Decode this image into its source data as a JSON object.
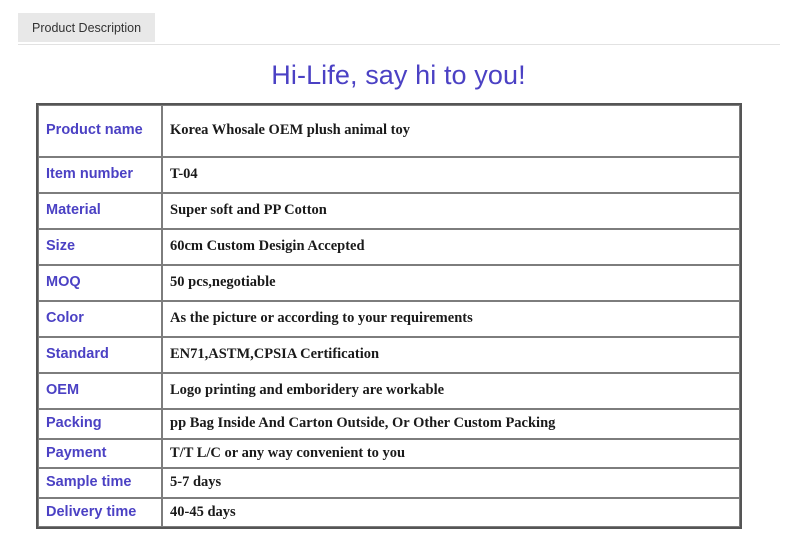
{
  "tabs": [
    {
      "label": "Product Description",
      "active": true
    }
  ],
  "heading": {
    "text": "Hi-Life, say hi to you!",
    "color": "#4b41c4"
  },
  "colors": {
    "label_purple": "#4b41c4",
    "value_black": "#1a1a1a",
    "tab_background": "#e8e8e8",
    "table_outer_border": "#555555",
    "table_cell_border": "#7d7d7d",
    "page_background": "#ffffff"
  },
  "spec_table": {
    "rows": [
      {
        "label": "Product name",
        "value": "Korea Whosale OEM plush animal toy",
        "size": "xtall"
      },
      {
        "label": "Item number",
        "value": "T-04",
        "size": "tall"
      },
      {
        "label": "Material",
        "value": "Super soft and PP Cotton",
        "size": "tall"
      },
      {
        "label": "Size",
        "value": "60cm Custom Desigin Accepted",
        "size": "tall"
      },
      {
        "label": "MOQ",
        "value": "50 pcs,negotiable",
        "size": "tall"
      },
      {
        "label": "Color",
        "value": "As the picture or according to your requirements",
        "size": "tall"
      },
      {
        "label": "Standard",
        "value": "EN71,ASTM,CPSIA Certification",
        "size": "tall"
      },
      {
        "label": "OEM",
        "value": "Logo printing and emboridery are workable",
        "size": "tall"
      },
      {
        "label": "Packing",
        "value": "pp Bag Inside And Carton Outside, Or Other Custom Packing",
        "size": "short"
      },
      {
        "label": "Payment",
        "value": "T/T L/C or any way convenient to you",
        "size": "short"
      },
      {
        "label": "Sample time",
        "value": "5-7 days",
        "size": "short"
      },
      {
        "label": "Delivery time",
        "value": "40-45 days",
        "size": "short"
      }
    ]
  }
}
